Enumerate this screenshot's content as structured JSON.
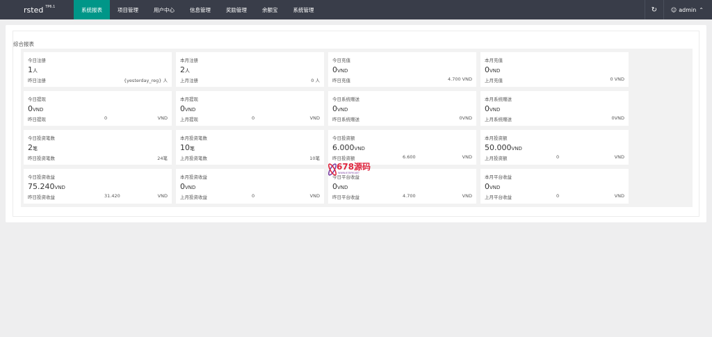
{
  "brand": {
    "name": "rsted",
    "version": "TP6.1"
  },
  "nav": {
    "items": [
      {
        "label": "系统报表",
        "active": true
      },
      {
        "label": "项目管理",
        "active": false
      },
      {
        "label": "用户中心",
        "active": false
      },
      {
        "label": "信息管理",
        "active": false
      },
      {
        "label": "奖励管理",
        "active": false
      },
      {
        "label": "余额宝",
        "active": false
      },
      {
        "label": "系统管理",
        "active": false
      }
    ]
  },
  "header": {
    "refresh_icon": "refresh-icon",
    "user_name": "admin"
  },
  "panel": {
    "title": "综合报表"
  },
  "stats": [
    {
      "label": "今日注册",
      "value": "1",
      "unit": "人",
      "foot_label": "昨日注册",
      "foot_mid": "",
      "foot_right": "{yesterday_reg} 人"
    },
    {
      "label": "本月注册",
      "value": "2",
      "unit": "人",
      "foot_label": "上月注册",
      "foot_mid": "",
      "foot_right": "0 人"
    },
    {
      "label": "今日充值",
      "value": "0",
      "unit": "VND",
      "foot_label": "昨日充值",
      "foot_mid": "",
      "foot_right": "4.700 VND"
    },
    {
      "label": "本月充值",
      "value": "0",
      "unit": "VND",
      "foot_label": "上月充值",
      "foot_mid": "",
      "foot_right": "0 VND"
    },
    {
      "label": "今日提现",
      "value": "0",
      "unit": "VND",
      "foot_label": "昨日提现",
      "foot_mid": "0",
      "foot_right": "VND"
    },
    {
      "label": "本月提现",
      "value": "0",
      "unit": "VND",
      "foot_label": "上月提现",
      "foot_mid": "0",
      "foot_right": "VND"
    },
    {
      "label": "今日系统赠送",
      "value": "0",
      "unit": "VND",
      "foot_label": "昨日系统赠送",
      "foot_mid": "",
      "foot_right": "0VND"
    },
    {
      "label": "本月系统赠送",
      "value": "0",
      "unit": "VND",
      "foot_label": "上月系统赠送",
      "foot_mid": "",
      "foot_right": "0VND"
    },
    {
      "label": "今日投资笔数",
      "value": "2",
      "unit": "笔",
      "foot_label": "昨日投资笔数",
      "foot_mid": "",
      "foot_right": "24笔"
    },
    {
      "label": "本月投资笔数",
      "value": "10",
      "unit": "笔",
      "foot_label": "上月投资笔数",
      "foot_mid": "",
      "foot_right": "10笔"
    },
    {
      "label": "今日投资额",
      "value": "6.000",
      "unit": "VND",
      "foot_label": "昨日投资额",
      "foot_mid": "6.600",
      "foot_right": "VND"
    },
    {
      "label": "本月投资额",
      "value": "50.000",
      "unit": "VND",
      "foot_label": "上月投资额",
      "foot_mid": "0",
      "foot_right": "VND"
    },
    {
      "label": "今日投资收益",
      "value": "75.240",
      "unit": "VND",
      "foot_label": "昨日投资收益",
      "foot_mid": "31.420",
      "foot_right": "VND"
    },
    {
      "label": "本月投资收益",
      "value": "0",
      "unit": "VND",
      "foot_label": "上月投资收益",
      "foot_mid": "0",
      "foot_right": "VND"
    },
    {
      "label": "今日平台收益",
      "value": "0",
      "unit": "VND",
      "foot_label": "昨日平台收益",
      "foot_mid": "4.700",
      "foot_right": "VND"
    },
    {
      "label": "本月平台收益",
      "value": "0",
      "unit": "VND",
      "foot_label": "上月平台收益",
      "foot_mid": "0",
      "foot_right": "VND"
    }
  ],
  "watermark": {
    "text": "678源码",
    "sub": "WWW.678YM.NET"
  }
}
